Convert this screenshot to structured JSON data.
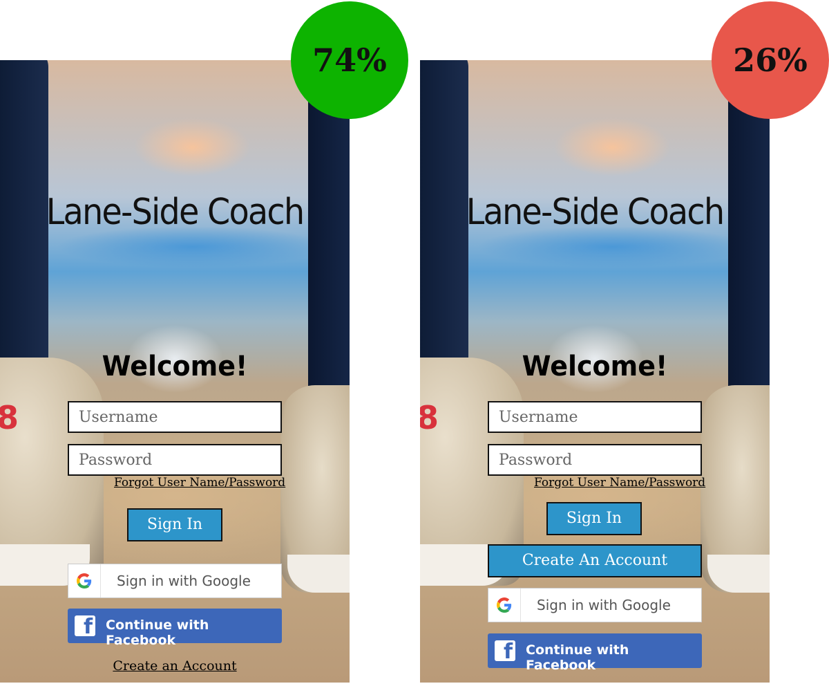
{
  "variant_a": {
    "badge_text": "74%",
    "badge_color": "#0db300",
    "app_title": "Lane-Side Coach",
    "welcome": "Welcome!",
    "username_placeholder": "Username",
    "password_placeholder": "Password",
    "forgot_link": "Forgot User Name/Password",
    "sign_in": "Sign In",
    "google_label": "Sign in with Google",
    "facebook_label": "Continue with Facebook",
    "create_link": "Create an Account"
  },
  "variant_b": {
    "badge_text": "26%",
    "badge_color": "#e8574b",
    "app_title": "Lane-Side Coach",
    "welcome": "Welcome!",
    "username_placeholder": "Username",
    "password_placeholder": "Password",
    "forgot_link": "Forgot User Name/Password",
    "sign_in": "Sign In",
    "create_account_button": "Create An Account",
    "google_label": "Sign in with Google",
    "facebook_label": "Continue with Facebook"
  },
  "colors": {
    "button_blue": "#2d95ca",
    "facebook_blue": "#3d67b9"
  },
  "icons": {
    "google": "google-g-icon",
    "facebook": "facebook-f-icon"
  }
}
